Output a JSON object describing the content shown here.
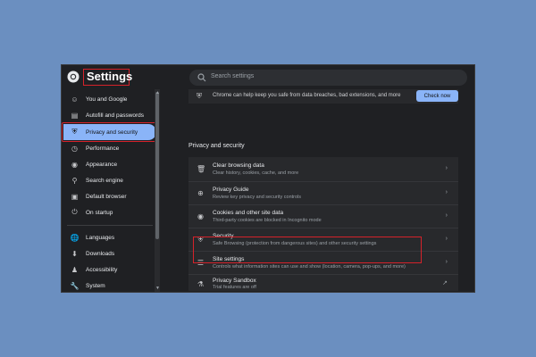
{
  "header": {
    "title": "Settings",
    "search_placeholder": "Search settings"
  },
  "sidebar": {
    "items": [
      {
        "label": "You and Google",
        "icon": "google-icon"
      },
      {
        "label": "Autofill and passwords",
        "icon": "autofill-icon"
      },
      {
        "label": "Privacy and security",
        "icon": "shield-icon",
        "active": true
      },
      {
        "label": "Performance",
        "icon": "performance-icon"
      },
      {
        "label": "Appearance",
        "icon": "palette-icon"
      },
      {
        "label": "Search engine",
        "icon": "search-icon"
      },
      {
        "label": "Default browser",
        "icon": "browser-icon"
      },
      {
        "label": "On startup",
        "icon": "power-icon"
      },
      {
        "label": "Languages",
        "icon": "globe-icon"
      },
      {
        "label": "Downloads",
        "icon": "download-icon"
      },
      {
        "label": "Accessibility",
        "icon": "accessibility-icon"
      },
      {
        "label": "System",
        "icon": "wrench-icon"
      }
    ]
  },
  "main": {
    "safety_text": "Chrome can help keep you safe from data breaches, bad extensions, and more",
    "check_now": "Check now",
    "section_title": "Privacy and security",
    "rows": [
      {
        "title": "Clear browsing data",
        "subtitle": "Clear history, cookies, cache, and more",
        "icon": "trash-icon"
      },
      {
        "title": "Privacy Guide",
        "subtitle": "Review key privacy and security controls",
        "icon": "guide-icon"
      },
      {
        "title": "Cookies and other site data",
        "subtitle": "Third-party cookies are blocked in Incognito mode",
        "icon": "cookie-icon"
      },
      {
        "title": "Security",
        "subtitle": "Safe Browsing (protection from dangerous sites) and other security settings",
        "icon": "shield-icon"
      },
      {
        "title": "Site settings",
        "subtitle": "Controls what information sites can use and show (location, camera, pop-ups, and more)",
        "icon": "sliders-icon"
      },
      {
        "title": "Privacy Sandbox",
        "subtitle": "Trial features are off",
        "icon": "flask-icon"
      }
    ]
  },
  "colors": {
    "accent": "#8ab4f8",
    "highlight": "#d5222a",
    "background": "#6b8fc0"
  }
}
